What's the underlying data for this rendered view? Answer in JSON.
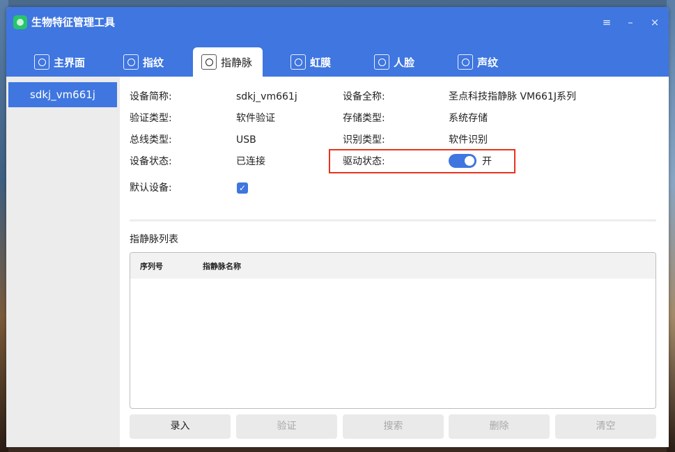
{
  "window": {
    "title": "生物特征管理工具",
    "menu_icon": "≡",
    "min_icon": "–",
    "close_icon": "×"
  },
  "tabs": [
    {
      "label": "主界面",
      "icon": "home-icon",
      "active": false
    },
    {
      "label": "指纹",
      "icon": "fingerprint-icon",
      "active": false
    },
    {
      "label": "指静脉",
      "icon": "finger-vein-icon",
      "active": true
    },
    {
      "label": "虹膜",
      "icon": "iris-icon",
      "active": false
    },
    {
      "label": "人脸",
      "icon": "face-icon",
      "active": false
    },
    {
      "label": "声纹",
      "icon": "voiceprint-icon",
      "active": false
    }
  ],
  "sidebar": {
    "items": [
      {
        "label": "sdkj_vm661j",
        "selected": true
      }
    ]
  },
  "device": {
    "short_name_label": "设备简称:",
    "short_name": "sdkj_vm661j",
    "full_name_label": "设备全称:",
    "full_name": "圣点科技指静脉 VM661J系列",
    "verify_type_label": "验证类型:",
    "verify_type": "软件验证",
    "storage_type_label": "存储类型:",
    "storage_type": "系统存储",
    "bus_type_label": "总线类型:",
    "bus_type": "USB",
    "identify_type_label": "识别类型:",
    "identify_type": "软件识别",
    "status_label": "设备状态:",
    "status": "已连接",
    "driver_status_label": "驱动状态:",
    "driver_status": "开",
    "driver_enabled": true,
    "default_label": "默认设备:",
    "default_checked": true
  },
  "list": {
    "title": "指静脉列表",
    "columns": [
      "序列号",
      "指静脉名称"
    ],
    "rows": []
  },
  "buttons": {
    "enroll": "录入",
    "verify": "验证",
    "search": "搜索",
    "delete": "删除",
    "clear": "清空"
  },
  "colors": {
    "accent": "#3f76e0",
    "highlight": "#e8321d"
  }
}
